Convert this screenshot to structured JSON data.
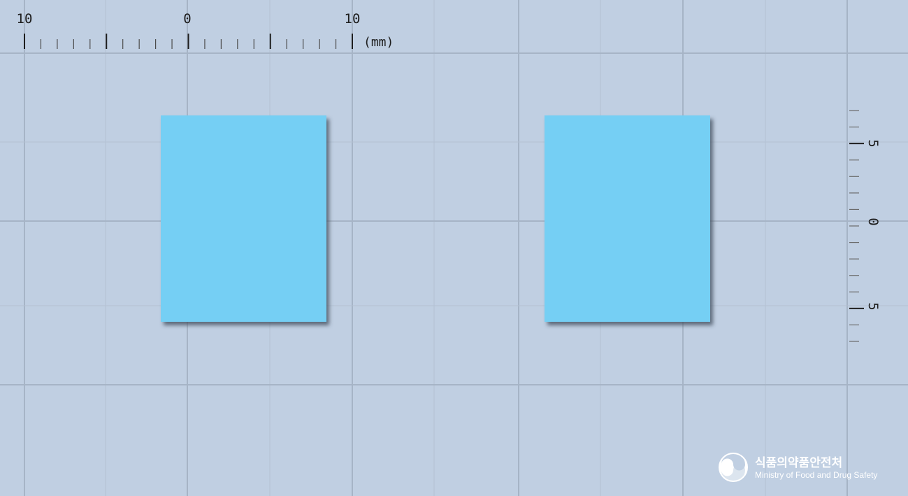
{
  "top_ruler": {
    "labels": [
      "10",
      "0",
      "10"
    ],
    "unit": "(mm)"
  },
  "side_ruler": {
    "labels": [
      "5",
      "0",
      "5"
    ]
  },
  "specimens": [
    {
      "name": "specimen-left"
    },
    {
      "name": "specimen-right"
    }
  ],
  "colors": {
    "background": "#c0cfe2",
    "grid_major": "#a6b4c6",
    "grid_minor": "#b3c1d3",
    "specimen_fill": "#74cff4",
    "specimen_shadow": "#5c6878",
    "logo_text": "#ffffff"
  },
  "logo": {
    "icon": "government-emblem-icon",
    "korean_name": "식품의약품안전처",
    "english_name": "Ministry of Food and Drug Safety"
  }
}
